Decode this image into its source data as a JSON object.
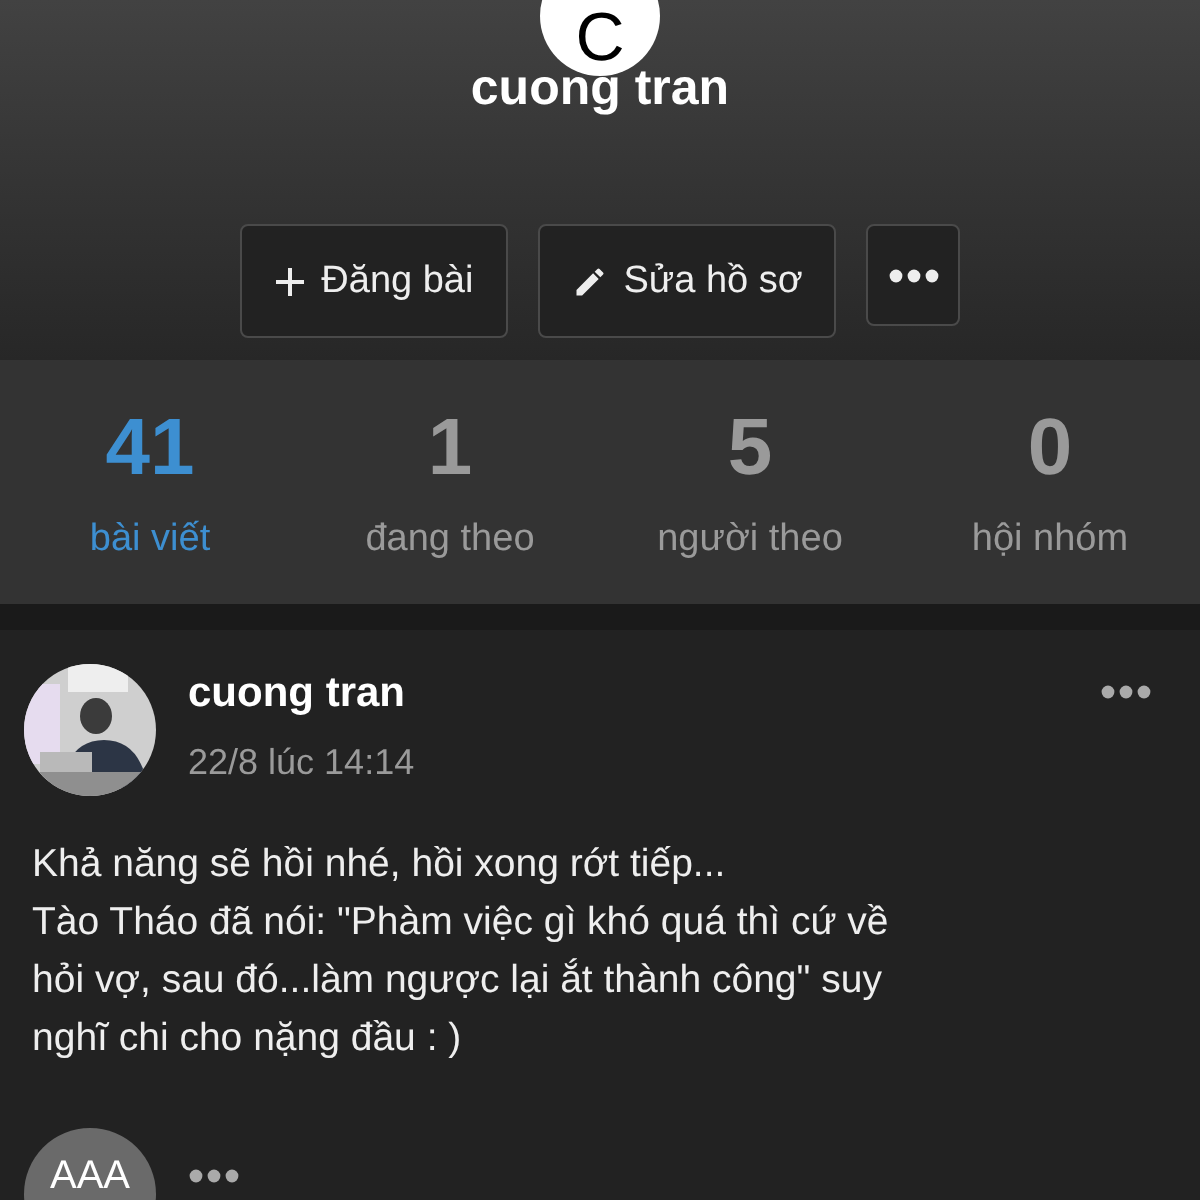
{
  "profile": {
    "avatar_letter": "C",
    "name": "cuong tran"
  },
  "actions": [
    {
      "kind": "plus",
      "label": "Đăng bài"
    },
    {
      "kind": "edit",
      "label": "Sửa hồ sơ"
    },
    {
      "kind": "more"
    }
  ],
  "stats": [
    {
      "value": "41",
      "label": "bài viết",
      "selected": true
    },
    {
      "value": "1",
      "label": "đang theo",
      "selected": false
    },
    {
      "value": "5",
      "label": "người theo",
      "selected": false
    },
    {
      "value": "0",
      "label": "hội nhóm",
      "selected": false
    }
  ],
  "post": {
    "author": "cuong tran",
    "time": "22/8 lúc 14:14",
    "body": "Khả năng sẽ hồi nhé, hồi xong rớt tiếp...\nTào Tháo đã nói: \"Phàm việc gì khó quá thì cứ về\nhỏi vợ, sau đó...làm ngược lại ắt thành công\" suy\nnghĩ chi cho nặng đầu : )"
  },
  "comment": {
    "avatar_text": "AAA"
  }
}
